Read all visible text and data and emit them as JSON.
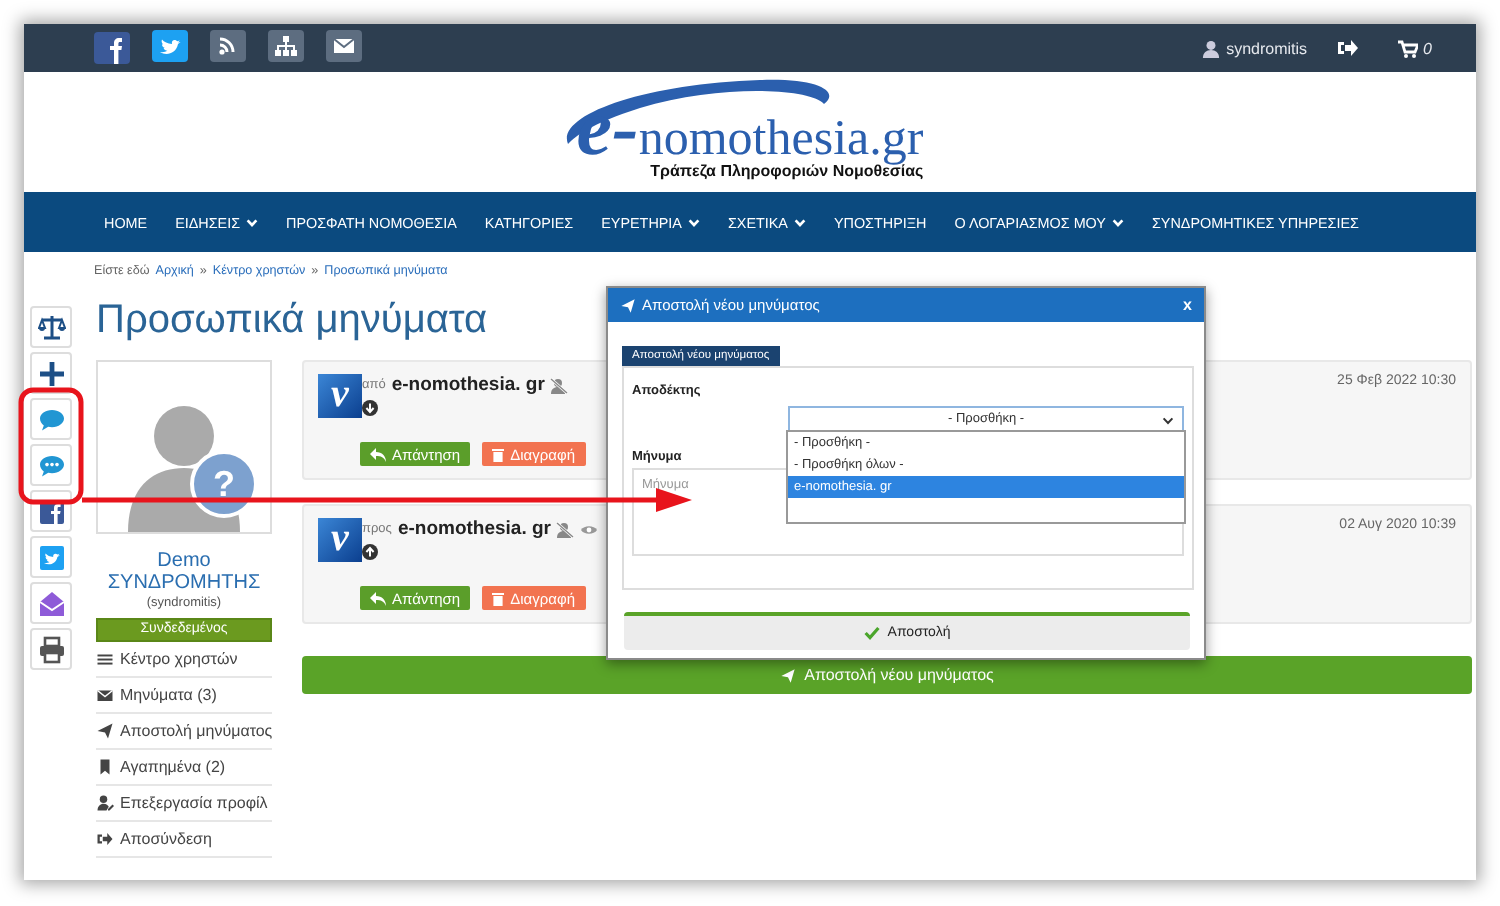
{
  "top_bar": {
    "username": "syndromitis",
    "cart_count": "0"
  },
  "header": {
    "logo_mark": "e-",
    "logo_text": "nomothesia.gr",
    "tagline": "Τράπεζα Πληροφοριών Νομοθεσίας"
  },
  "nav": [
    {
      "label": "HOME",
      "dropdown": false
    },
    {
      "label": "ΕΙΔΗΣΕΙΣ",
      "dropdown": true
    },
    {
      "label": "ΠΡΟΣΦΑΤΗ ΝΟΜΟΘΕΣΙΑ",
      "dropdown": false
    },
    {
      "label": "ΚΑΤΗΓΟΡΙΕΣ",
      "dropdown": false
    },
    {
      "label": "ΕΥΡΕΤΗΡΙΑ",
      "dropdown": true
    },
    {
      "label": "ΣΧΕΤΙΚΑ",
      "dropdown": true
    },
    {
      "label": "ΥΠΟΣΤΗΡΙΞΗ",
      "dropdown": false
    },
    {
      "label": "Ο ΛΟΓΑΡΙΑΣΜΟΣ ΜΟΥ",
      "dropdown": true
    },
    {
      "label": "ΣΥΝΔΡΟΜΗΤΙΚΕΣ ΥΠΗΡΕΣΙΕΣ",
      "dropdown": false
    }
  ],
  "breadcrumb": {
    "prefix": "Είστε εδώ",
    "separator": "»",
    "items": [
      "Αρχική",
      "Κέντρο χρηστών",
      "Προσωπικά μηνύματα"
    ]
  },
  "page_title": "Προσωπικά μηνύματα",
  "profile": {
    "badge": "?",
    "name": "Demo",
    "role": "ΣΥΝΔΡΟΜΗΤΗΣ",
    "username": "(syndromitis)",
    "status": "Συνδεδεμένος"
  },
  "user_menu": [
    "Κέντρο χρηστών",
    "Μηνύματα (3)",
    "Αποστολή μηνύματος",
    "Αγαπημένα (2)",
    "Επεξεργασία προφίλ",
    "Αποσύνδεση"
  ],
  "messages": [
    {
      "kind": "received",
      "avatar": "v",
      "direction": "από",
      "sender": "e-nomothesia. gr",
      "seen": false,
      "date": "25 Φεβ 2022 10:30",
      "reply": "Απάντηση",
      "delete": "Διαγραφή"
    },
    {
      "kind": "sent",
      "avatar": "v",
      "direction": "προς",
      "sender": "e-nomothesia. gr",
      "seen": true,
      "date": "02 Αυγ 2020 10:39",
      "reply": "Απάντηση",
      "delete": "Διαγραφή"
    }
  ],
  "new_message_button": "Αποστολή νέου μηνύματος",
  "modal": {
    "title": "Αποστολή νέου μηνύματος",
    "close": "x",
    "tab": "Αποστολή νέου μηνύματος",
    "recipient_label": "Αποδέκτης",
    "select_value": "- Προσθήκη -",
    "options": [
      {
        "label": "- Προσθήκη -",
        "selected": false
      },
      {
        "label": "- Προσθήκη όλων -",
        "selected": false
      },
      {
        "label": "e-nomothesia. gr",
        "selected": true
      }
    ],
    "message_label": "Μήνυμα",
    "message_placeholder": "Μήνυμα",
    "submit": "Αποστολή"
  }
}
